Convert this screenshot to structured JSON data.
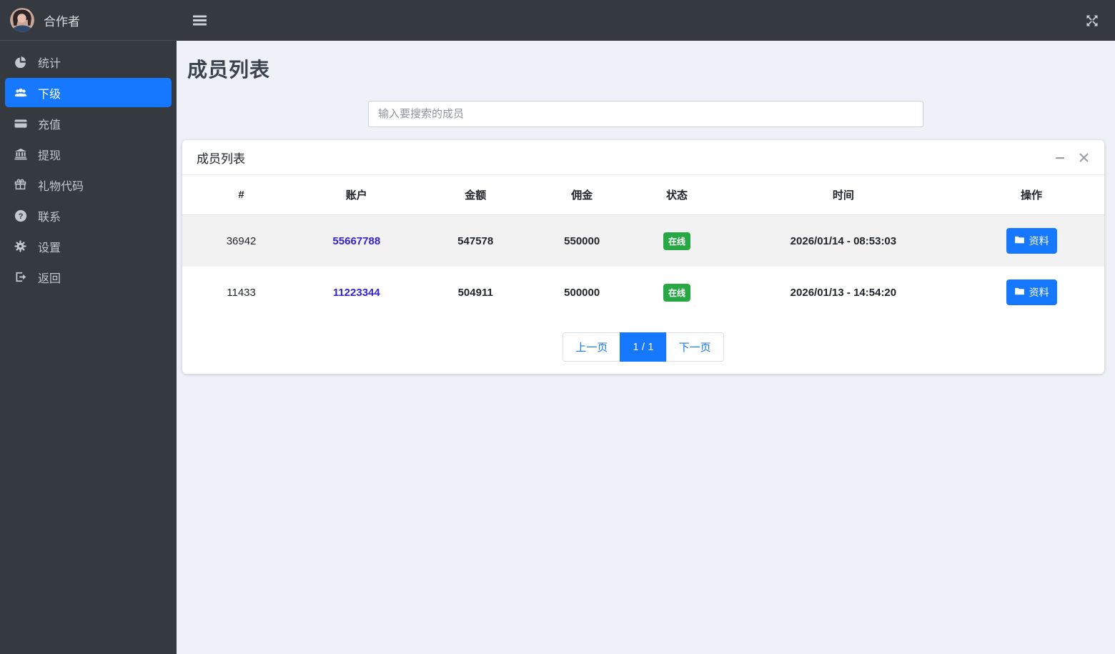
{
  "topbar": {
    "menu_icon": "hamburger-icon",
    "fullscreen_icon": "expand-arrows-icon"
  },
  "sidebar": {
    "brand": "合作者",
    "avatar_icon": "user-photo-avatar",
    "items": [
      {
        "label": "统计",
        "icon": "pie-chart-icon",
        "active": false
      },
      {
        "label": "下级",
        "icon": "users-icon",
        "active": true
      },
      {
        "label": "充值",
        "icon": "credit-card-icon",
        "active": false
      },
      {
        "label": "提现",
        "icon": "bank-icon",
        "active": false
      },
      {
        "label": "礼物代码",
        "icon": "gift-icon",
        "active": false
      },
      {
        "label": "联系",
        "icon": "question-circle-icon",
        "active": false
      },
      {
        "label": "设置",
        "icon": "gear-icon",
        "active": false
      },
      {
        "label": "返回",
        "icon": "sign-out-icon",
        "active": false
      }
    ]
  },
  "page": {
    "title": "成员列表"
  },
  "search": {
    "placeholder": "输入要搜索的成员"
  },
  "card": {
    "title": "成员列表",
    "tools": {
      "minimize_icon": "minimize-icon",
      "close_icon": "close-icon"
    }
  },
  "table": {
    "headers": [
      "#",
      "账户",
      "金额",
      "佣金",
      "状态",
      "时间",
      "操作"
    ],
    "rows": [
      {
        "id": "36942",
        "account": "55667788",
        "amount": "547578",
        "commission": "550000",
        "status": "在线",
        "time": "2026/01/14 - 08:53:03",
        "action": "资料",
        "action_icon": "folder-icon"
      },
      {
        "id": "11433",
        "account": "11223344",
        "amount": "504911",
        "commission": "500000",
        "status": "在线",
        "time": "2026/01/13 - 14:54:20",
        "action": "资料",
        "action_icon": "folder-icon"
      }
    ]
  },
  "pagination": {
    "prev_label": "上一页",
    "page_indicator": "1 / 1",
    "next_label": "下一页"
  },
  "colors": {
    "accent_blue": "#1677ff",
    "online_green": "#28a745",
    "sidebar_dark": "#343a40",
    "account_link": "#3323d1",
    "page_background": "#eef1f8"
  }
}
